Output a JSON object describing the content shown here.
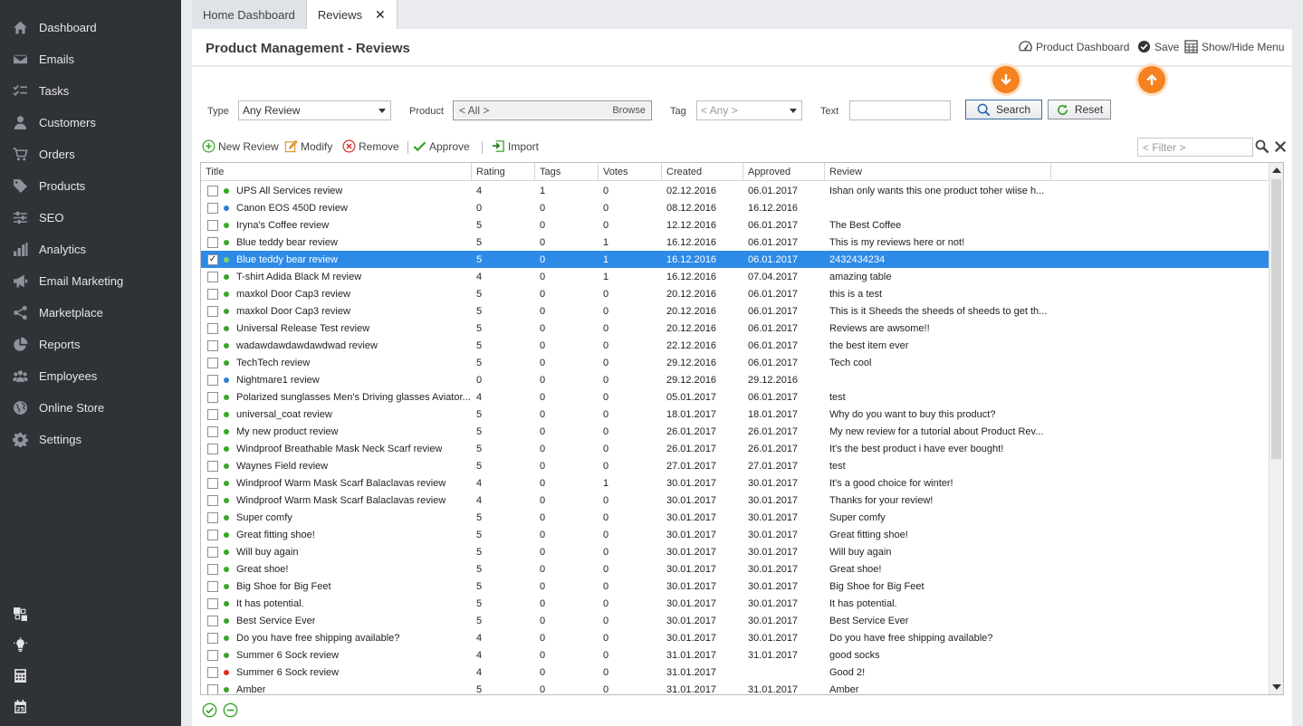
{
  "sidebar": {
    "items": [
      {
        "label": "Dashboard",
        "icon": "home-icon"
      },
      {
        "label": "Emails",
        "icon": "envelope-icon"
      },
      {
        "label": "Tasks",
        "icon": "checklist-icon"
      },
      {
        "label": "Customers",
        "icon": "person-icon"
      },
      {
        "label": "Orders",
        "icon": "cart-icon"
      },
      {
        "label": "Products",
        "icon": "tag-icon"
      },
      {
        "label": "SEO",
        "icon": "sliders-icon"
      },
      {
        "label": "Analytics",
        "icon": "bar-chart-icon"
      },
      {
        "label": "Email Marketing",
        "icon": "megaphone-icon"
      },
      {
        "label": "Marketplace",
        "icon": "share-icon"
      },
      {
        "label": "Reports",
        "icon": "pie-chart-icon"
      },
      {
        "label": "Employees",
        "icon": "group-icon"
      },
      {
        "label": "Online Store",
        "icon": "globe-icon"
      },
      {
        "label": "Settings",
        "icon": "gear-icon"
      }
    ]
  },
  "tabs": [
    {
      "label": "Home Dashboard"
    },
    {
      "label": "Reviews",
      "close": "✕"
    }
  ],
  "header": {
    "title": "Product Management - Reviews",
    "product_dashboard": "Product Dashboard",
    "save": "Save",
    "show_hide_menu": "Show/Hide Menu"
  },
  "filters": {
    "type_label": "Type",
    "type_value": "Any Review",
    "product_label": "Product",
    "product_value": "< All >",
    "browse": "Browse",
    "tag_label": "Tag",
    "tag_value": "< Any >",
    "text_label": "Text",
    "search": "Search",
    "reset": "Reset"
  },
  "toolbar": {
    "new_review": "New Review",
    "modify": "Modify",
    "remove": "Remove",
    "approve": "Approve",
    "import": "Import",
    "filter_placeholder": "< Filter >"
  },
  "grid": {
    "columns": [
      "Title",
      "Rating",
      "Tags",
      "Votes",
      "Created",
      "Approved",
      "Review"
    ],
    "rows": [
      {
        "status": "green",
        "title": "UPS All Services review",
        "rating": "4",
        "tags": "1",
        "votes": "0",
        "created": "02.12.2016",
        "approved": "06.01.2017",
        "review": "Ishan only wants this one product toher wiise h..."
      },
      {
        "status": "blue",
        "title": "Canon EOS 450D review",
        "rating": "0",
        "tags": "0",
        "votes": "0",
        "created": "08.12.2016",
        "approved": "16.12.2016",
        "review": ""
      },
      {
        "status": "green",
        "title": "Iryna's Coffee review",
        "rating": "5",
        "tags": "0",
        "votes": "0",
        "created": "12.12.2016",
        "approved": "06.01.2017",
        "review": "The Best Coffee"
      },
      {
        "status": "green",
        "title": "Blue teddy bear review",
        "rating": "5",
        "tags": "0",
        "votes": "1",
        "created": "16.12.2016",
        "approved": "06.01.2017",
        "review": "This is my reviews here or not!"
      },
      {
        "status": "green",
        "title": "Blue teddy bear review",
        "rating": "5",
        "tags": "0",
        "votes": "1",
        "created": "16.12.2016",
        "approved": "06.01.2017",
        "review": "2432434234",
        "selected": true
      },
      {
        "status": "green",
        "title": "T-shirt Adida Black M review",
        "rating": "4",
        "tags": "0",
        "votes": "1",
        "created": "16.12.2016",
        "approved": "07.04.2017",
        "review": "amazing table"
      },
      {
        "status": "green",
        "title": "maxkol Door Cap3 review",
        "rating": "5",
        "tags": "0",
        "votes": "0",
        "created": "20.12.2016",
        "approved": "06.01.2017",
        "review": "this is a test"
      },
      {
        "status": "green",
        "title": "maxkol Door Cap3 review",
        "rating": "5",
        "tags": "0",
        "votes": "0",
        "created": "20.12.2016",
        "approved": "06.01.2017",
        "review": "This is it Sheeds the sheeds of sheeds to get th..."
      },
      {
        "status": "green",
        "title": "Universal Release Test review",
        "rating": "5",
        "tags": "0",
        "votes": "0",
        "created": "20.12.2016",
        "approved": "06.01.2017",
        "review": "Reviews are awsome!!"
      },
      {
        "status": "green",
        "title": "wadawdawdawdawdwad review",
        "rating": "5",
        "tags": "0",
        "votes": "0",
        "created": "22.12.2016",
        "approved": "06.01.2017",
        "review": "the best item ever"
      },
      {
        "status": "green",
        "title": "TechTech review",
        "rating": "5",
        "tags": "0",
        "votes": "0",
        "created": "29.12.2016",
        "approved": "06.01.2017",
        "review": "Tech cool"
      },
      {
        "status": "blue",
        "title": "Nightmare1 review",
        "rating": "0",
        "tags": "0",
        "votes": "0",
        "created": "29.12.2016",
        "approved": "29.12.2016",
        "review": ""
      },
      {
        "status": "green",
        "title": "Polarized sunglasses Men's Driving glasses Aviator...",
        "rating": "4",
        "tags": "0",
        "votes": "0",
        "created": "05.01.2017",
        "approved": "06.01.2017",
        "review": "test"
      },
      {
        "status": "green",
        "title": "universal_coat review",
        "rating": "5",
        "tags": "0",
        "votes": "0",
        "created": "18.01.2017",
        "approved": "18.01.2017",
        "review": "Why do you want to buy this product?"
      },
      {
        "status": "green",
        "title": "My new product review",
        "rating": "5",
        "tags": "0",
        "votes": "0",
        "created": "26.01.2017",
        "approved": "26.01.2017",
        "review": "My new review for a tutorial about Product Rev..."
      },
      {
        "status": "green",
        "title": "Windproof Breathable Mask Neck Scarf review",
        "rating": "5",
        "tags": "0",
        "votes": "0",
        "created": "26.01.2017",
        "approved": "26.01.2017",
        "review": "It's the best product i have ever bought!"
      },
      {
        "status": "green",
        "title": "Waynes Field review",
        "rating": "5",
        "tags": "0",
        "votes": "0",
        "created": "27.01.2017",
        "approved": "27.01.2017",
        "review": "test"
      },
      {
        "status": "green",
        "title": "Windproof Warm Mask Scarf Balaclavas review",
        "rating": "4",
        "tags": "0",
        "votes": "1",
        "created": "30.01.2017",
        "approved": "30.01.2017",
        "review": "It's a good choice for winter!"
      },
      {
        "status": "green",
        "title": "Windproof Warm Mask Scarf Balaclavas review",
        "rating": "4",
        "tags": "0",
        "votes": "0",
        "created": "30.01.2017",
        "approved": "30.01.2017",
        "review": "Thanks for your review!"
      },
      {
        "status": "green",
        "title": "Super comfy",
        "rating": "5",
        "tags": "0",
        "votes": "0",
        "created": "30.01.2017",
        "approved": "30.01.2017",
        "review": "Super comfy"
      },
      {
        "status": "green",
        "title": "Great fitting shoe!",
        "rating": "5",
        "tags": "0",
        "votes": "0",
        "created": "30.01.2017",
        "approved": "30.01.2017",
        "review": "Great fitting shoe!"
      },
      {
        "status": "green",
        "title": "Will buy again",
        "rating": "5",
        "tags": "0",
        "votes": "0",
        "created": "30.01.2017",
        "approved": "30.01.2017",
        "review": "Will buy again"
      },
      {
        "status": "green",
        "title": "Great shoe!",
        "rating": "5",
        "tags": "0",
        "votes": "0",
        "created": "30.01.2017",
        "approved": "30.01.2017",
        "review": "Great shoe!"
      },
      {
        "status": "green",
        "title": "Big Shoe for Big Feet",
        "rating": "5",
        "tags": "0",
        "votes": "0",
        "created": "30.01.2017",
        "approved": "30.01.2017",
        "review": "Big Shoe for Big Feet"
      },
      {
        "status": "green",
        "title": "It has potential.",
        "rating": "5",
        "tags": "0",
        "votes": "0",
        "created": "30.01.2017",
        "approved": "30.01.2017",
        "review": "It has potential."
      },
      {
        "status": "green",
        "title": "Best Service Ever",
        "rating": "5",
        "tags": "0",
        "votes": "0",
        "created": "30.01.2017",
        "approved": "30.01.2017",
        "review": "Best Service Ever"
      },
      {
        "status": "green",
        "title": "Do you have free shipping available?",
        "rating": "4",
        "tags": "0",
        "votes": "0",
        "created": "30.01.2017",
        "approved": "30.01.2017",
        "review": "Do you have free shipping available?"
      },
      {
        "status": "green",
        "title": "Summer 6 Sock review",
        "rating": "4",
        "tags": "0",
        "votes": "0",
        "created": "31.01.2017",
        "approved": "31.01.2017",
        "review": "good socks"
      },
      {
        "status": "red",
        "title": "Summer 6 Sock review",
        "rating": "4",
        "tags": "0",
        "votes": "0",
        "created": "31.01.2017",
        "approved": "",
        "review": "Good 2!"
      },
      {
        "status": "green",
        "title": "Amber",
        "rating": "5",
        "tags": "0",
        "votes": "0",
        "created": "31.01.2017",
        "approved": "31.01.2017",
        "review": "Amber"
      }
    ]
  },
  "colors": {
    "sidebar_bg": "#2f3237",
    "accent_orange": "#f5821f",
    "selection_blue": "#2d8ae6",
    "status_green": "#3aa52b",
    "status_blue": "#2f7fd1",
    "status_red": "#d6312b"
  }
}
